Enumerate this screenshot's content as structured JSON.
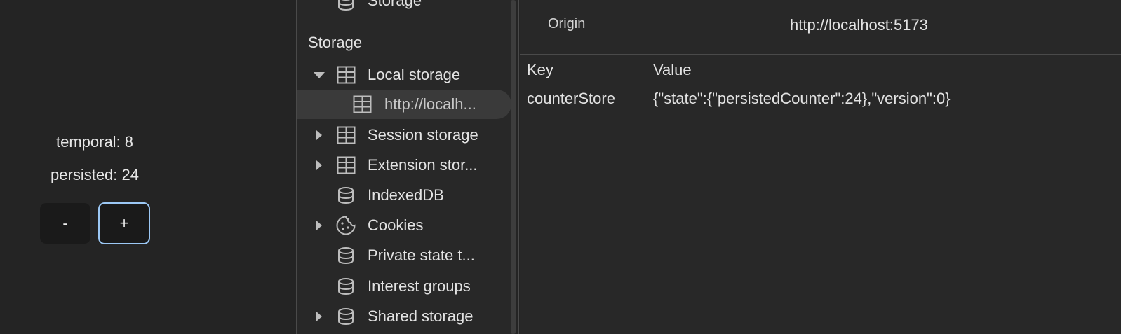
{
  "app": {
    "temporal_text": "temporal: 8",
    "persisted_text": "persisted: 24",
    "minus_label": "-",
    "plus_label": "+"
  },
  "sidebar": {
    "top_partial_item": "Storage",
    "section_title": "Storage",
    "items": [
      {
        "label": "Local storage",
        "icon": "table-icon",
        "expanded": true
      },
      {
        "label": "http://localh...",
        "icon": "table-icon",
        "selected": true
      },
      {
        "label": "Session storage",
        "icon": "table-icon",
        "expanded": false
      },
      {
        "label": "Extension stor...",
        "icon": "table-icon",
        "expanded": false
      },
      {
        "label": "IndexedDB",
        "icon": "database-icon"
      },
      {
        "label": "Cookies",
        "icon": "cookie-icon",
        "expanded": false
      },
      {
        "label": "Private state t...",
        "icon": "database-icon"
      },
      {
        "label": "Interest groups",
        "icon": "database-icon"
      },
      {
        "label": "Shared storage",
        "icon": "database-icon",
        "expanded": false
      }
    ]
  },
  "main": {
    "origin_label": "Origin",
    "origin_value": "http://localhost:5173",
    "columns": [
      "Key",
      "Value"
    ],
    "rows": [
      {
        "key": "counterStore",
        "value": "{\"state\":{\"persistedCounter\":24},\"version\":0}"
      }
    ]
  },
  "colors": {
    "background": "#242424",
    "panel": "#282828",
    "focus_ring": "#9cc8f5"
  }
}
